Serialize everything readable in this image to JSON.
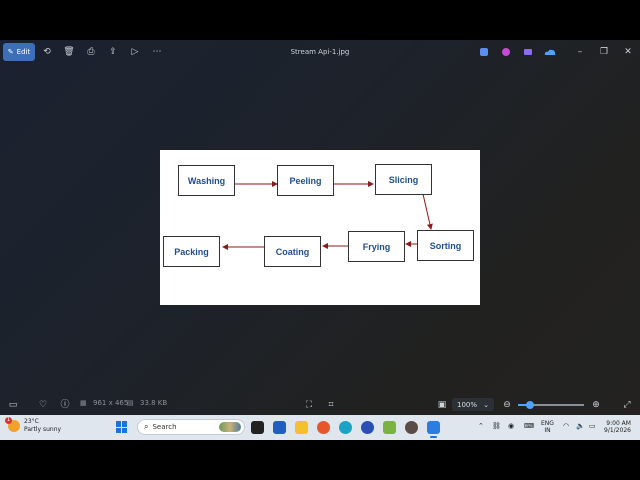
{
  "titlebar": {
    "edit_label": "Edit",
    "file_name": "Stream Api-1.jpg"
  },
  "diagram": {
    "nodes": [
      "Washing",
      "Peeling",
      "Slicing",
      "Sorting",
      "Frying",
      "Coating",
      "Packing"
    ],
    "edge_color": "#8b1a1a",
    "node_text_color": "#1f4e8c"
  },
  "statusbar": {
    "dimensions": "961 x 465",
    "file_size": "33.8 KB",
    "zoom_value": "100%",
    "zoom_fraction": 0.18
  },
  "taskbar": {
    "weather_alert": "1",
    "temperature": "23°C",
    "weather_desc": "Partly sunny",
    "search_label": "Search",
    "lang_line1": "ENG",
    "lang_line2": "IN",
    "time": "9:00 AM",
    "date": "9/1/2026"
  }
}
